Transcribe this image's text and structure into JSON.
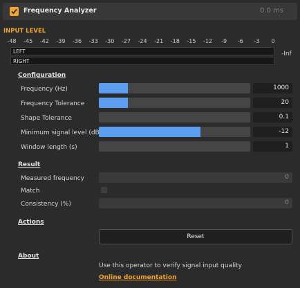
{
  "header": {
    "title": "Frequency Analyzer",
    "time": "0.0 ms",
    "enabled": true
  },
  "input_level": {
    "title": "INPUT LEVEL",
    "scale": [
      "-48",
      "-45",
      "-42",
      "-39",
      "-36",
      "-33",
      "-30",
      "-27",
      "-24",
      "-21",
      "-18",
      "-15",
      "-12",
      "-9",
      "-6",
      "-3",
      "0"
    ],
    "left_label": "LEFT",
    "right_label": "RIGHT",
    "readout": "-Inf"
  },
  "configuration": {
    "title": "Configuration",
    "params": [
      {
        "label": "Frequency (Hz)",
        "value": "1000",
        "fill": 0.19
      },
      {
        "label": "Frequency Tolerance",
        "value": "20",
        "fill": 0.19
      },
      {
        "label": "Shape Tolerance",
        "value": "0.1",
        "fill": 0.0
      },
      {
        "label": "Minimum signal level (dB)",
        "value": "-12",
        "fill": 0.67
      },
      {
        "label": "Window length (s)",
        "value": "1",
        "fill": 0.0
      }
    ]
  },
  "result": {
    "title": "Result",
    "measured_label": "Measured frequency",
    "measured_value": "0",
    "match_label": "Match",
    "consistency_label": "Consistency (%)",
    "consistency_value": "0"
  },
  "actions": {
    "title": "Actions",
    "reset_label": "Reset"
  },
  "about": {
    "title": "About",
    "description": "Use this operator to verify signal input quality",
    "link_label": "Online documentation"
  },
  "colors": {
    "accent": "#f2a530",
    "slider_fill": "#5b9ef0"
  },
  "icons": {
    "enable": "checkmark-icon"
  }
}
